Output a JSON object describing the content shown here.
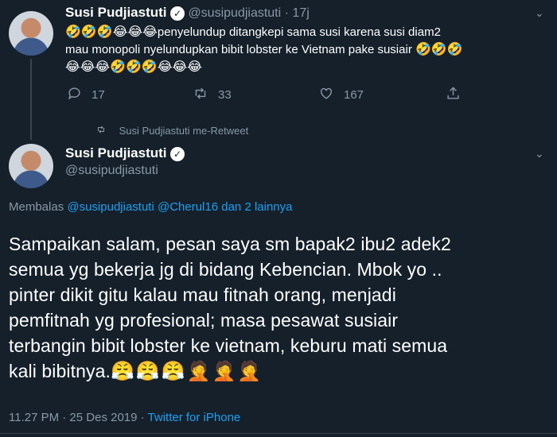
{
  "tweet1": {
    "name": "Susi Pudjiastuti",
    "handle": "@susipudjiastuti",
    "time": "· 17j",
    "emoji_lead": "🤣🤣🤣😂😂😂",
    "text_a": "penyelundup ditangkepi sama susi karena susi diam2",
    "text_b": "mau monopoli nyelundupkan bibit lobster ke Vietnam pake susiair",
    "emoji_tail_1": "🤣🤣🤣",
    "emoji_tail_2": "😂😂😂🤣🤣🤣😂😂😂",
    "actions": {
      "reply": "17",
      "retweet": "33",
      "like": "167"
    }
  },
  "retweet_note": "Susi Pudjiastuti me-Retweet",
  "tweet2": {
    "name": "Susi Pudjiastuti",
    "handle": "@susipudjiastuti",
    "reply_prefix": "Membalas ",
    "reply_users": "@susipudjiastuti @Cherul16",
    "reply_suffix": " dan 2 lainnya",
    "lines": [
      "Sampaikan salam, pesan saya sm bapak2 ibu2 adek2",
      "semua yg bekerja jg di bidang Kebencian. Mbok yo ..",
      "pinter dikit gitu kalau mau fitnah orang, menjadi",
      "pemfitnah yg profesional; masa pesawat susiair",
      "terbangin bibit lobster ke vietnam, keburu mati semua"
    ],
    "last_line": "kali bibitnya.",
    "last_emoji": "😤😤😤🤦🤦🤦",
    "timestamp": "11.27 PM · 25 Des 2019 · ",
    "source": "Twitter for iPhone"
  },
  "icons": {
    "reply": "speech-bubble",
    "retweet": "retweet-arrows",
    "like": "heart",
    "share": "share-upload",
    "verified": "check-badge"
  }
}
